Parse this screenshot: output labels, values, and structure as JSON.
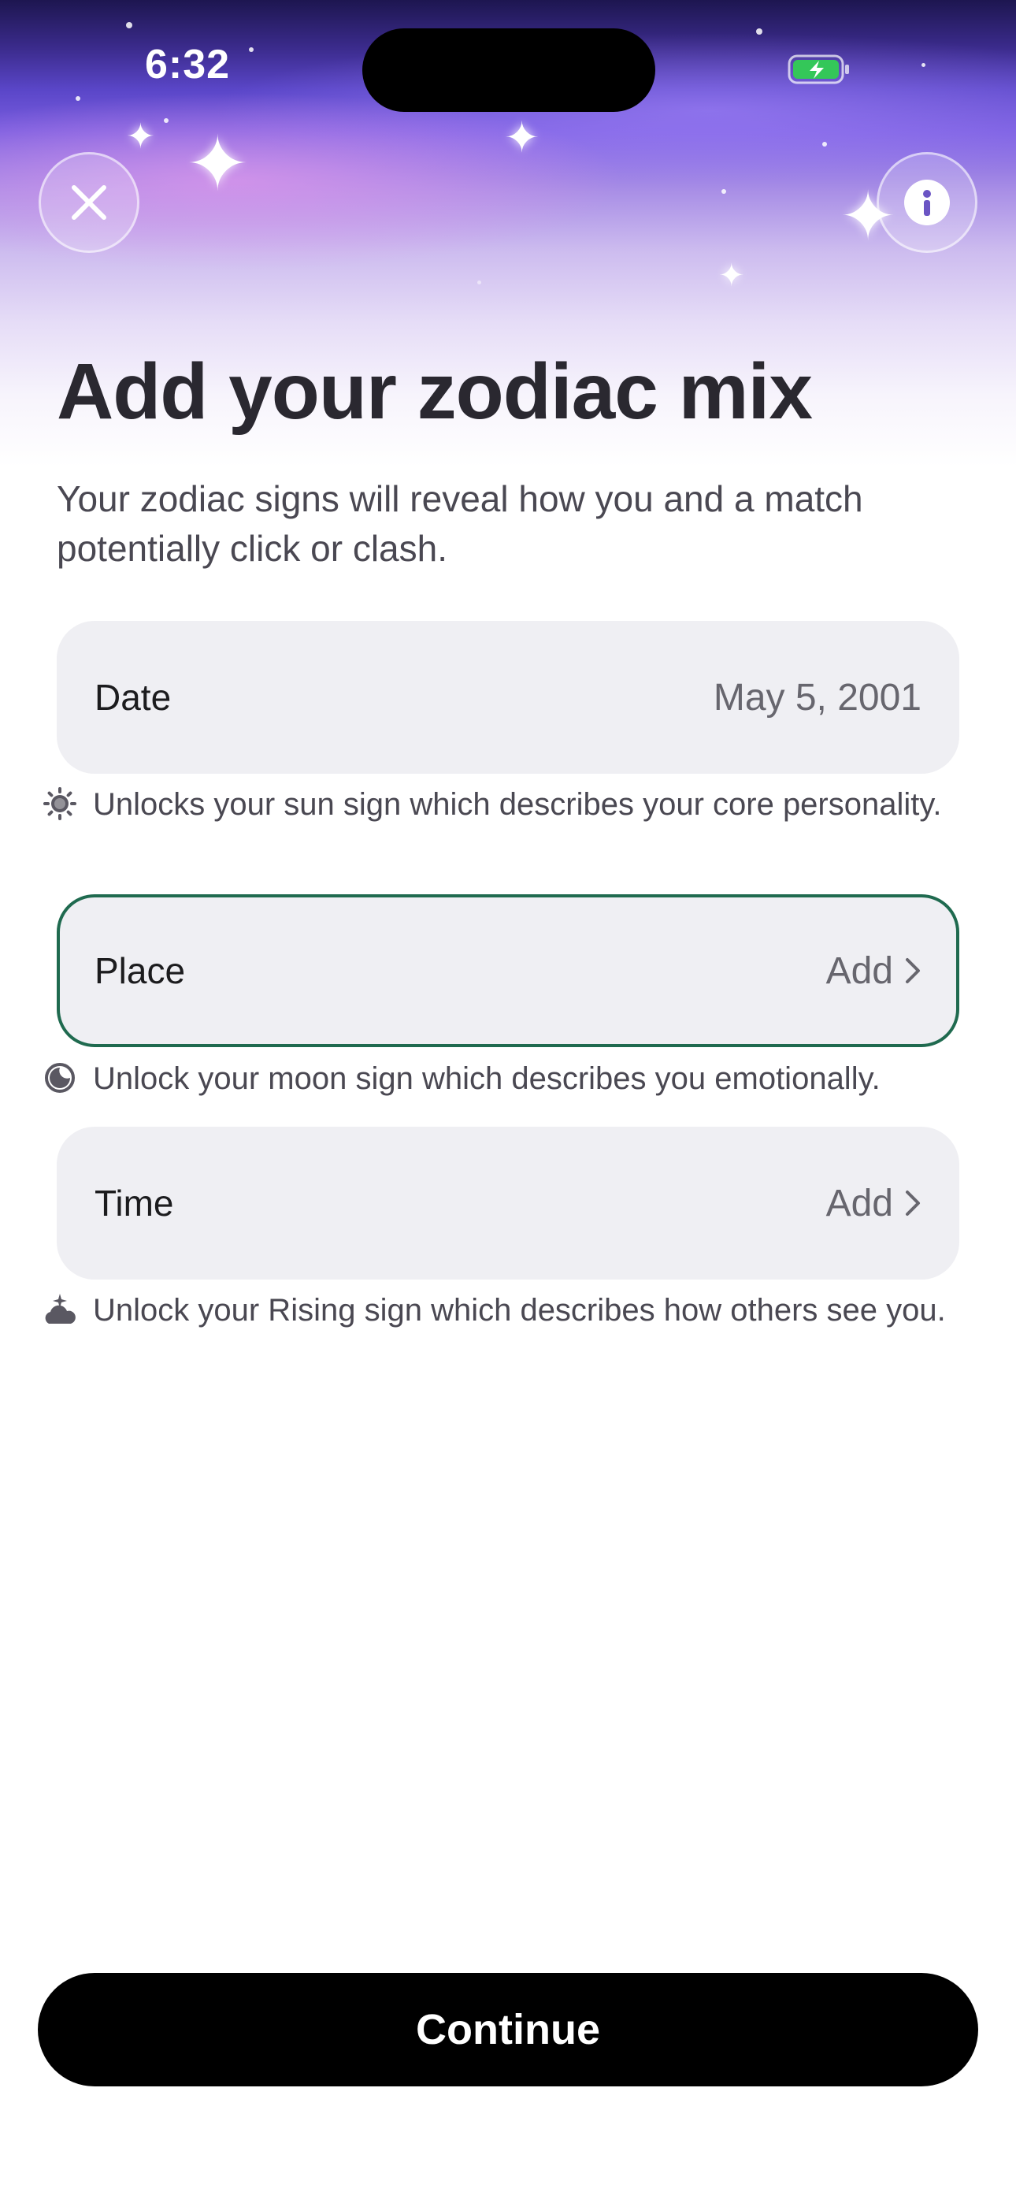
{
  "status_bar": {
    "time": "6:32",
    "battery_icon": "battery-charging-icon",
    "battery_color": "#34c759"
  },
  "header": {
    "close_icon": "close-icon",
    "info_icon": "info-icon",
    "title": "Add your zodiac mix",
    "subtitle": "Your zodiac signs will reveal how you and a match potentially click or clash."
  },
  "fields": {
    "date": {
      "label": "Date",
      "value": "May 5, 2001",
      "hint_icon": "sun-icon",
      "hint": "Unlocks your sun sign which describes your core personality."
    },
    "place": {
      "label": "Place",
      "value": "Add",
      "focused": true,
      "focus_color": "#1f6a4f",
      "hint_icon": "moon-icon",
      "hint": "Unlock your moon sign which describes you emotionally."
    },
    "time": {
      "label": "Time",
      "value": "Add",
      "hint_icon": "rising-cloud-icon",
      "hint": "Unlock your Rising sign which describes how others see you."
    }
  },
  "footer": {
    "continue_label": "Continue"
  },
  "colors": {
    "hero_top": "#1d1650",
    "hero_mid": "#7a5ee0",
    "field_bg": "#efeff3",
    "button_bg": "#000000"
  }
}
